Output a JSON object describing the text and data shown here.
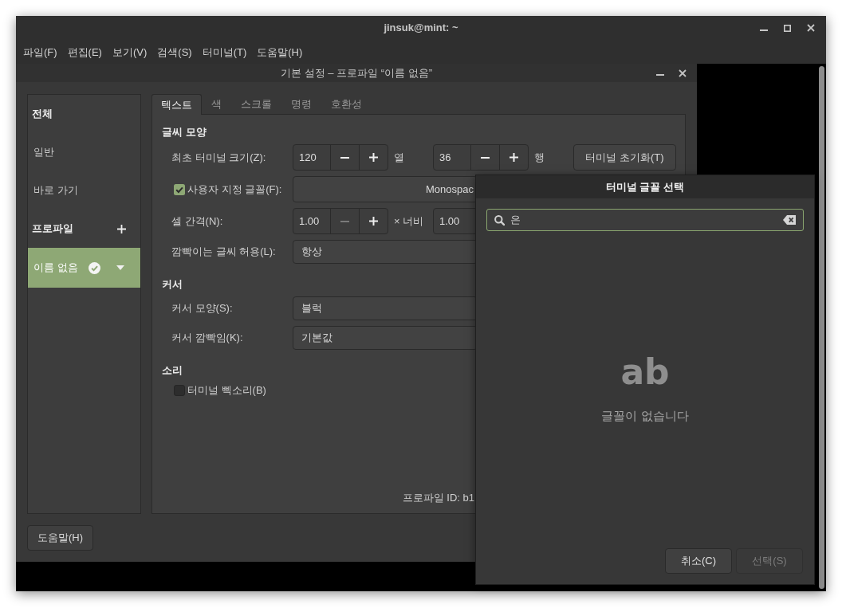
{
  "terminal_window": {
    "title": "jinsuk@mint: ~",
    "menu": [
      "파일(F)",
      "편집(E)",
      "보기(V)",
      "검색(S)",
      "터미널(T)",
      "도움말(H)"
    ]
  },
  "preferences_window": {
    "title": "기본 설정 – 프로파일 “이름 없음”",
    "sidebar": {
      "items": [
        {
          "kind": "heading",
          "label": "전체"
        },
        {
          "kind": "item",
          "label": "일반",
          "selected": false
        },
        {
          "kind": "item",
          "label": "바로 가기",
          "selected": false
        },
        {
          "kind": "heading_add",
          "label": "프로파일"
        },
        {
          "kind": "profile",
          "label": "이름 없음",
          "selected": true,
          "default": true
        }
      ]
    },
    "tabs": [
      {
        "label": "텍스트",
        "selected": true
      },
      {
        "label": "색",
        "selected": false
      },
      {
        "label": "스크롤",
        "selected": false
      },
      {
        "label": "명령",
        "selected": false
      },
      {
        "label": "호환성",
        "selected": false
      }
    ],
    "page": {
      "sections": [
        {
          "title": "글씨 모양",
          "rows": [
            {
              "kind": "spin",
              "label": "최초 터미널 크기(Z):",
              "spins": [
                {
                  "value": "120",
                  "unit": "열",
                  "buttons": [
                    {
                      "kind": "minus",
                      "disabled": false
                    },
                    {
                      "kind": "plus",
                      "disabled": false
                    }
                  ]
                },
                {
                  "value": "36",
                  "unit": "행",
                  "buttons": [
                    {
                      "kind": "minus",
                      "disabled": false
                    },
                    {
                      "kind": "plus",
                      "disabled": false
                    }
                  ]
                }
              ],
              "button": "터미널 초기화(T)"
            },
            {
              "kind": "font",
              "label": "사용자 지정 글꼴(F):",
              "checked": true,
              "value": "Monospac"
            },
            {
              "kind": "spin",
              "label": "셀 간격(N):",
              "spins": [
                {
                  "value": "1.00",
                  "unit": "× 너비",
                  "buttons": [
                    {
                      "kind": "minus",
                      "disabled": true
                    },
                    {
                      "kind": "plus",
                      "disabled": false
                    }
                  ]
                },
                {
                  "value": "1.00"
                }
              ]
            },
            {
              "kind": "combo",
              "label": "깜빡이는 글씨 허용(L):",
              "value": "항상"
            }
          ]
        },
        {
          "title": "커서",
          "rows": [
            {
              "kind": "combo",
              "label": "커서 모양(S):",
              "value": "블럭"
            },
            {
              "kind": "combo",
              "label": "커서 깜빡임(K):",
              "value": "기본값"
            }
          ]
        },
        {
          "title": "소리",
          "rows": [
            {
              "kind": "check",
              "label": "터미널 삑소리(B)",
              "checked": false
            }
          ]
        }
      ],
      "profile_id": "프로파일 ID: b1"
    },
    "help_button": "도움말(H)"
  },
  "font_dialog": {
    "title": "터미널 글꼴 선택",
    "search": {
      "value": "은"
    },
    "empty_state": {
      "glyph": "ab",
      "message": "글꼴이 없습니다"
    },
    "buttons": [
      {
        "label": "취소(C)",
        "disabled": false
      },
      {
        "label": "선택(S)",
        "disabled": true
      }
    ]
  }
}
